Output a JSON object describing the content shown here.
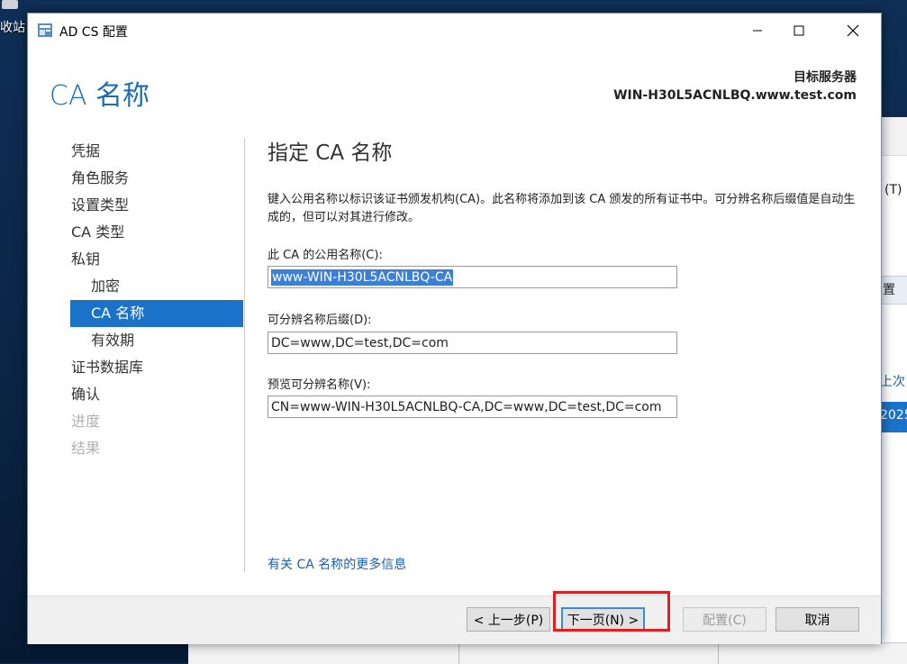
{
  "desktop": {
    "icon_label": "收站"
  },
  "background_window": {
    "fragment_t": "(T)",
    "fragment_settings": "置",
    "fragment_last": "上次",
    "fragment_year": "2025"
  },
  "dialog": {
    "title": "AD CS 配置",
    "header_title": "CA 名称",
    "target_server_label": "目标服务器",
    "target_server_value": "WIN-H30L5ACNLBQ.www.test.com",
    "nav": [
      {
        "label": "凭据",
        "state": "normal"
      },
      {
        "label": "角色服务",
        "state": "normal"
      },
      {
        "label": "设置类型",
        "state": "normal"
      },
      {
        "label": "CA 类型",
        "state": "normal"
      },
      {
        "label": "私钥",
        "state": "normal"
      },
      {
        "label": "加密",
        "state": "sub"
      },
      {
        "label": "CA 名称",
        "state": "active"
      },
      {
        "label": "有效期",
        "state": "sub"
      },
      {
        "label": "证书数据库",
        "state": "normal"
      },
      {
        "label": "确认",
        "state": "normal"
      },
      {
        "label": "进度",
        "state": "disabled"
      },
      {
        "label": "结果",
        "state": "disabled"
      }
    ],
    "section_title": "指定 CA 名称",
    "description": "键入公用名称以标识该证书颁发机构(CA)。此名称将添加到该 CA 颁发的所有证书中。可分辨名称后缀值是自动生成的，但可以对其进行修改。",
    "common_name_label": "此 CA 的公用名称(C):",
    "common_name_value": "www-WIN-H30L5ACNLBQ-CA",
    "dn_suffix_label": "可分辨名称后缀(D):",
    "dn_suffix_value": "DC=www,DC=test,DC=com",
    "preview_label": "预览可分辨名称(V):",
    "preview_value": "CN=www-WIN-H30L5ACNLBQ-CA,DC=www,DC=test,DC=com",
    "more_info_link": "有关 CA 名称的更多信息",
    "buttons": {
      "prev": "< 上一步(P)",
      "next": "下一页(N) >",
      "configure": "配置(C)",
      "cancel": "取消"
    }
  },
  "colors": {
    "accent": "#1a73c8",
    "header_blue": "#1c6db4",
    "highlight_red": "#e02020"
  }
}
